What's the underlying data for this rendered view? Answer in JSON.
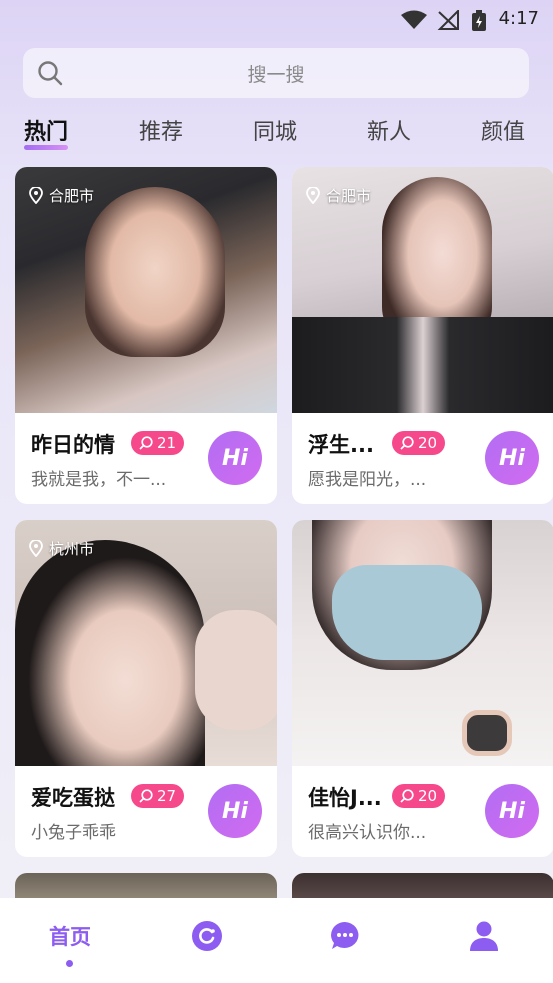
{
  "status": {
    "time": "4:17",
    "icons": [
      "wifi-icon",
      "signal-off-icon",
      "battery-charging-icon"
    ]
  },
  "search": {
    "placeholder": "搜一搜"
  },
  "tabs": [
    "热门",
    "推荐",
    "同城",
    "新人",
    "颜值"
  ],
  "active_tab": "热门",
  "cards": [
    {
      "location": "合肥市",
      "name": "昨日的情",
      "count": "21",
      "signature": "我就是我，不一...",
      "hi": "Hi"
    },
    {
      "location": "合肥市",
      "name": "浮生...",
      "count": "20",
      "signature": "愿我是阳光，...",
      "hi": "Hi"
    },
    {
      "location": "杭州市",
      "name": "爱吃蛋挞",
      "count": "27",
      "signature": "小兔子乖乖",
      "hi": "Hi"
    },
    {
      "location": "",
      "name": "佳怡J...",
      "count": "20",
      "signature": "很高兴认识你...",
      "hi": "Hi"
    }
  ],
  "nav": {
    "home_label": "首页",
    "icons": [
      "discover-icon",
      "message-icon",
      "profile-icon"
    ]
  },
  "colors": {
    "accent": "#8c5df0",
    "badge": "#f5498c"
  }
}
